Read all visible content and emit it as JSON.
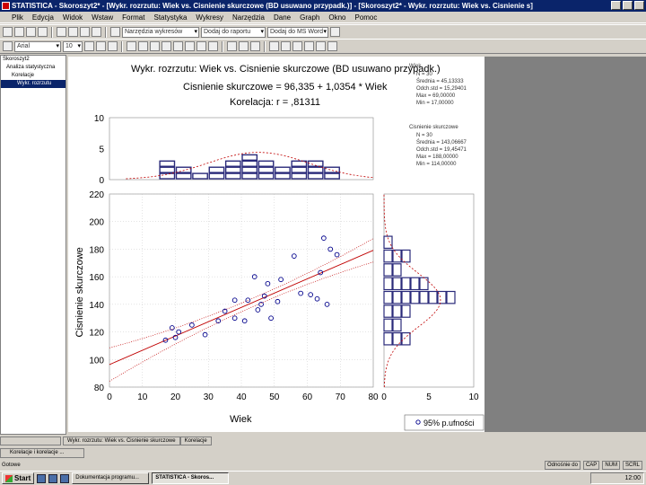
{
  "window": {
    "title": "STATISTICA - Skoroszyt2* - [Wykr. rozrzutu: Wiek     vs. Cisnienie skurczowe (BD usuwano przypadk.)] - [Skoroszyt2* - Wykr. rozrzutu: Wiek     vs. Cisnienie s]"
  },
  "menubar": {
    "items": [
      "Plik",
      "Edycja",
      "Widok",
      "Wstaw",
      "Format",
      "Statystyka",
      "Wykresy",
      "Narzędzia",
      "Dane",
      "Graph",
      "Okno",
      "Pomoc"
    ]
  },
  "toolbar": {
    "combo_font": "Arial",
    "combo_size": "10",
    "combo_nowy": "Narzędzia wykresów",
    "combo_raport": "Dodaj do raportu",
    "combo_ms": "Dodaj do MS Word"
  },
  "tree": {
    "items": [
      "Skoroszyt2",
      "Analiza statystyczna",
      "Korelacje",
      "Wykr. rozrzutu"
    ]
  },
  "chart_data": {
    "type": "scatter",
    "title_lines": [
      "Wykr. rozrzutu: Wiek     vs. Cisnienie skurczowe (BD usuwano przypadk.)",
      "Cisnienie skurczowe = 96,335 + 1,0354 * Wiek",
      "Korelacja: r =    ,81311"
    ],
    "xlabel": "Wiek",
    "ylabel": "Cisnienie skurczowe",
    "xlim": [
      0,
      80
    ],
    "ylim": [
      80,
      220
    ],
    "x_ticks": [
      "0",
      "10",
      "20",
      "30",
      "40",
      "50",
      "60",
      "70",
      "80"
    ],
    "y_ticks": [
      "80",
      "100",
      "120",
      "140",
      "160",
      "180",
      "200",
      "220"
    ],
    "regression": {
      "intercept": 96.335,
      "slope": 1.0354
    },
    "points": [
      {
        "x": 17,
        "y": 114
      },
      {
        "x": 19,
        "y": 123
      },
      {
        "x": 20,
        "y": 116
      },
      {
        "x": 21,
        "y": 120
      },
      {
        "x": 25,
        "y": 125
      },
      {
        "x": 29,
        "y": 118
      },
      {
        "x": 33,
        "y": 128
      },
      {
        "x": 35,
        "y": 135
      },
      {
        "x": 38,
        "y": 130
      },
      {
        "x": 38,
        "y": 143
      },
      {
        "x": 41,
        "y": 128
      },
      {
        "x": 42,
        "y": 143
      },
      {
        "x": 44,
        "y": 160
      },
      {
        "x": 45,
        "y": 136
      },
      {
        "x": 46,
        "y": 140
      },
      {
        "x": 47,
        "y": 146
      },
      {
        "x": 48,
        "y": 155
      },
      {
        "x": 49,
        "y": 130
      },
      {
        "x": 51,
        "y": 142
      },
      {
        "x": 52,
        "y": 158
      },
      {
        "x": 56,
        "y": 175
      },
      {
        "x": 58,
        "y": 148
      },
      {
        "x": 61,
        "y": 147
      },
      {
        "x": 63,
        "y": 144
      },
      {
        "x": 64,
        "y": 163
      },
      {
        "x": 65,
        "y": 188
      },
      {
        "x": 66,
        "y": 140
      },
      {
        "x": 67,
        "y": 180
      },
      {
        "x": 69,
        "y": 176
      }
    ],
    "top_histogram": {
      "ylim": [
        0,
        10
      ],
      "y_ticks": [
        "0",
        "5",
        "10"
      ],
      "bins_x": [
        17.5,
        22.5,
        27.5,
        32.5,
        37.5,
        42.5,
        47.5,
        52.5,
        57.5,
        62.5,
        67.5
      ],
      "counts": [
        3,
        2,
        1,
        2,
        3,
        4,
        3,
        2,
        3,
        3,
        2
      ]
    },
    "right_histogram": {
      "xlim": [
        0,
        10
      ],
      "x_ticks": [
        "0",
        "5",
        "10"
      ],
      "bins_y": [
        115,
        125,
        135,
        145,
        155,
        165,
        175,
        185
      ],
      "counts": [
        3,
        2,
        3,
        8,
        5,
        2,
        3,
        1
      ]
    },
    "stats_var1": {
      "name": "Wiek",
      "lines": [
        "N = 30",
        "Średnia = 45,13333",
        "Odch.std = 15,29401",
        "Max = 69,00000",
        "Min = 17,00000"
      ]
    },
    "stats_var2": {
      "name": "Cisnienie skurczowe",
      "lines": [
        "N = 30",
        "Średnia = 143,06667",
        "Odch.std = 19,45471",
        "Max = 188,00000",
        "Min = 114,00000"
      ]
    },
    "legend_ci": "95% p.ufności",
    "colors": {
      "points": "#00008b",
      "regression": "#c00000",
      "histogram": "#2a2a7a"
    }
  },
  "bottom_tabs": [
    "Wykr. rozrzutu: Wiek vs. Cisnienie skurczowe",
    "Korelacje"
  ],
  "subwindow_label": "Korelacje i korelacje ...",
  "status": {
    "left": "Gotowe",
    "right": [
      "Odnośnie do",
      "CAP",
      "NUM",
      "SCRL"
    ]
  },
  "taskbar": {
    "start_label": "Start",
    "buttons": [
      "Dokumentacja programu...",
      "STATISTICA - Skoros..."
    ],
    "clock": "12:00"
  }
}
